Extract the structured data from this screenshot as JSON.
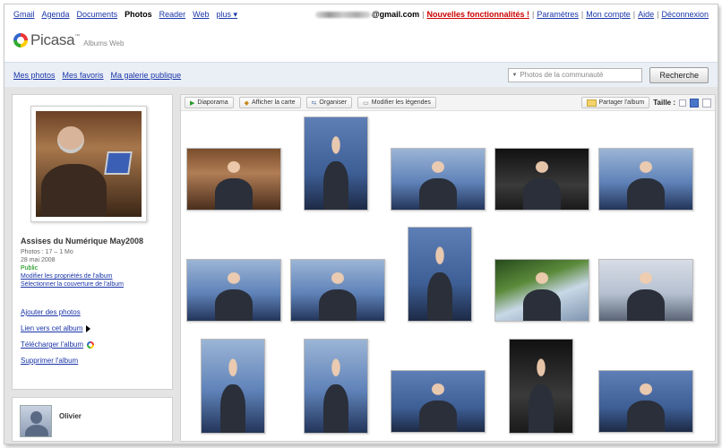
{
  "gbar": {
    "links": [
      "Gmail",
      "Agenda",
      "Documents",
      "Photos",
      "Reader",
      "Web",
      "plus ▾"
    ],
    "current": "Photos",
    "email": "@gmail.com",
    "new_features": "Nouvelles fonctionnalités !",
    "settings": "Paramètres",
    "account": "Mon compte",
    "help": "Aide",
    "logout": "Déconnexion",
    "separator": "|"
  },
  "logo": {
    "name": "Picasa",
    "tm": "™",
    "subtitle": "Albums Web"
  },
  "subnav": {
    "tabs": [
      "Mes photos",
      "Mes favoris",
      "Ma galerie publique"
    ],
    "search_placeholder": "Photos de la communauté",
    "search_button": "Recherche"
  },
  "toolbar": {
    "slideshow": "Diaporama",
    "map": "Afficher la carte",
    "organize": "Organiser",
    "captions": "Modifier les légendes",
    "share": "Partager l'album",
    "size_label": "Taille :"
  },
  "album": {
    "title": "Assises du Numérique May2008",
    "count": "Photos : 17 – 1 Mo",
    "date": "28 mai 2008",
    "visibility": "Public",
    "edit_props": "Modifier les propriétés de l'album",
    "select_cover": "Sélectionner la couverture de l'album",
    "actions": {
      "add": "Ajouter des photos",
      "link": "Lien vers cet album",
      "download": "Télécharger l'album",
      "delete": "Supprimer l'album"
    }
  },
  "owner": {
    "name": "Olivier"
  },
  "colors": {
    "link": "#1a35a8",
    "new_features": "#cc0000",
    "public": "#008000",
    "panel_bg": "#e4e4e4",
    "subnav_bg": "#eaeff6"
  },
  "icons": [
    "play-icon",
    "map-icon",
    "organize-icon",
    "caption-icon",
    "share-icon",
    "size-small-icon",
    "size-medium-icon",
    "size-large-icon",
    "arrow-right-icon",
    "picasa-download-icon"
  ]
}
